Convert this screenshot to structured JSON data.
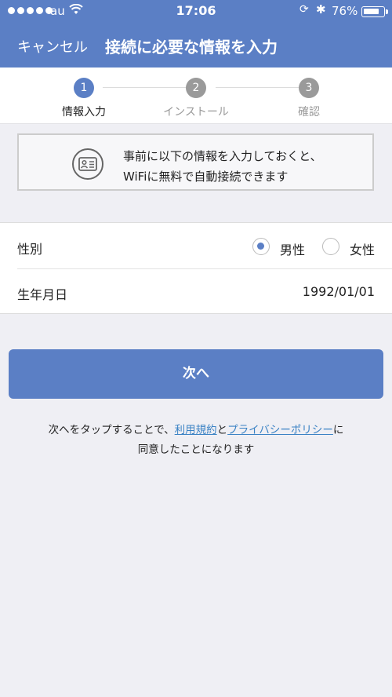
{
  "status_bar": {
    "carrier": "au",
    "time": "17:06",
    "battery": "76%",
    "battery_level": 0.76
  },
  "header": {
    "cancel_label": "キャンセル",
    "title": "接続に必要な情報を入力"
  },
  "steps": [
    {
      "number": "1",
      "label": "情報入力",
      "active": true
    },
    {
      "number": "2",
      "label": "インストール",
      "active": false
    },
    {
      "number": "3",
      "label": "確認",
      "active": false
    }
  ],
  "notice": {
    "line1": "事前に以下の情報を入力しておくと、",
    "line2": "WiFiに無料で自動接続できます"
  },
  "form": {
    "gender_label": "性別",
    "gender_options": [
      {
        "label": "男性",
        "selected": true
      },
      {
        "label": "女性",
        "selected": false
      }
    ],
    "birthday_label": "生年月日",
    "birthday_value": "1992/01/01"
  },
  "next_button": "次へ",
  "terms": {
    "prefix": "次へをタップすることで、",
    "link1": "利用規約",
    "connector": "と",
    "link2": "プライバシーポリシー",
    "suffix": "に",
    "line2": "同意したことになります"
  },
  "colors": {
    "accent": "#5b7fc5",
    "link": "#3a82c4",
    "inactive_step": "#9a9a9a"
  }
}
